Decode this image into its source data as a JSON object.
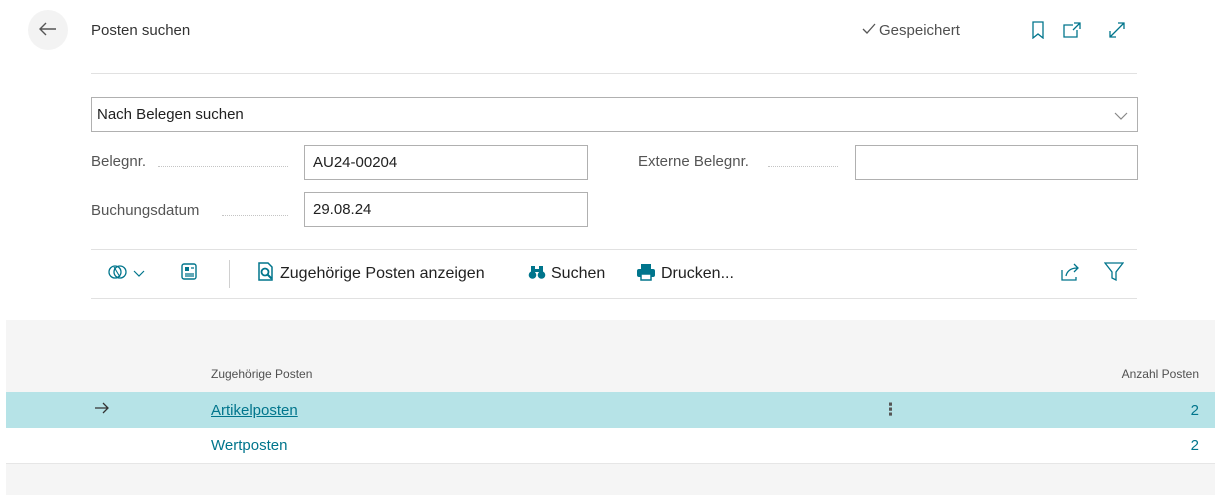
{
  "header": {
    "back_icon": "arrow-left-icon",
    "title": "Posten suchen",
    "saved_label": "Gespeichert",
    "icons": [
      "bookmark-icon",
      "open-new-window-icon",
      "expand-icon"
    ]
  },
  "search_mode": {
    "selected": "Nach Belegen suchen"
  },
  "fields": {
    "belegnr": {
      "label": "Belegnr.",
      "value": "AU24-00204"
    },
    "externe_belegnr": {
      "label": "Externe Belegnr.",
      "value": ""
    },
    "buchungsdatum": {
      "label": "Buchungsdatum",
      "value": "29.08.24"
    }
  },
  "actions": {
    "view_icon": "view-mode-icon",
    "details_icon": "details-pane-icon",
    "show_related": "Zugehörige Posten anzeigen",
    "search": "Suchen",
    "print": "Drucken...",
    "share_icon": "share-icon",
    "filter_icon": "filter-icon"
  },
  "list": {
    "col_related": "Zugehörige Posten",
    "col_count": "Anzahl Posten",
    "rows": [
      {
        "name": "Artikelposten",
        "count": "2",
        "selected": true
      },
      {
        "name": "Wertposten",
        "count": "2",
        "selected": false
      }
    ]
  },
  "colors": {
    "accent": "#00758c",
    "selected_row": "#b6e3e7"
  }
}
